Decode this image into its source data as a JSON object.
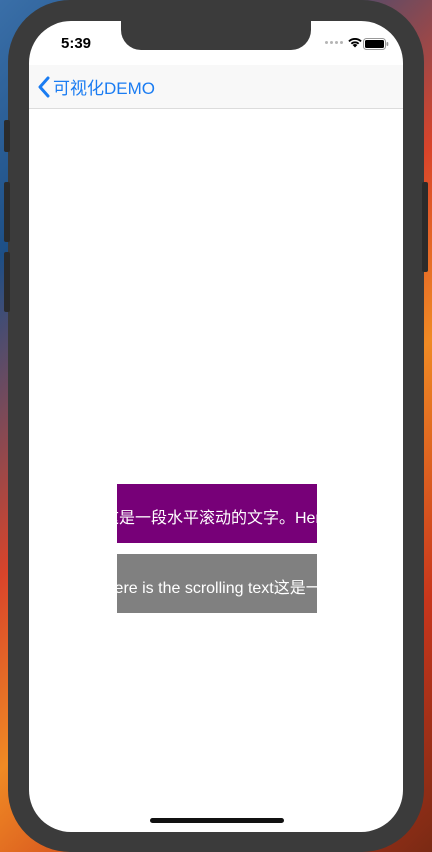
{
  "status_bar": {
    "time": "5:39"
  },
  "navbar": {
    "back_label": "可视化DEMO"
  },
  "marquees": [
    {
      "text": "这是一段水平滚动的文字。Here is the scrolling text",
      "color": "#770078"
    },
    {
      "text": "Here is the scrolling text这是一段水平滚动的文字。",
      "color": "#808080"
    }
  ],
  "colors": {
    "accent": "#1a7cf2"
  },
  "icons": [
    "chevron-left-icon",
    "signal-dots-icon",
    "wifi-icon",
    "battery-icon"
  ]
}
